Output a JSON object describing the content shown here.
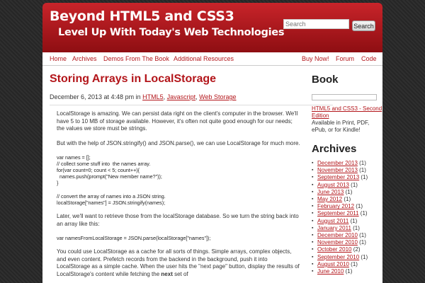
{
  "header": {
    "title": "Beyond HTML5 and CSS3",
    "tagline": "Level Up With Today's Web Technologies",
    "search_placeholder": "Search",
    "search_button": "Search"
  },
  "nav": {
    "left": [
      "Home",
      "Archives",
      "Demos From The Book",
      "Additional Resources"
    ],
    "right": [
      "Buy Now!",
      "Forum",
      "Code"
    ]
  },
  "post": {
    "title": "Storing Arrays in LocalStorage",
    "date_prefix": "December 6, 2013 at 4:48 pm in ",
    "categories": [
      "HTML5",
      "Javascript",
      "Web Storage"
    ],
    "paragraph_1": "LocalStorage is amazing. We can persist data right on the client's computer in the browser.  We'll have 5 to 10 MB of storage available.  However, it's often not quite good enough for our needs; the values we store must be strings.",
    "paragraph_2": "But with the help of JSON.stringify() and JSON.parse(), we can use LocalStorage for much more.",
    "code_1": "var names = [];\n// collect some stuff into  the names array.\nfor(var count=0; count < 5; count++){\n  names.push(prompt(\"New member name?\"));\n}",
    "code_2": "// convert the array of names into a JSON string.\nlocalStorage[\"names\"] = JSON.stringify(names);",
    "paragraph_3": "Later, we'll want to retrieve those from the localStorage database. So we turn the string back into an array like this:",
    "code_3": "var namesFromLocalStorage = JSON.parse(localStorage[\"names\"]);",
    "paragraph_4_before_bold": "You could use LocalStorage as a cache for all sorts of things. Simple arrays, complex objects, and even content. Prefetch records from the backend in the background, push it into LocalStorage as a simple cache. When the user hits the \"next page\" button, display the results of LocalStorage's content while fetching the ",
    "paragraph_4_bold": "next",
    "paragraph_4_after_bold": " set of"
  },
  "sidebar": {
    "book_title": "Book",
    "book_link": "HTML5 and CSS3 - Second Edition",
    "book_desc": "Available in Print, PDF, ePub, or for Kindle!",
    "archives_title": "Archives",
    "archives": [
      {
        "label": "December 2013",
        "count": " (1)"
      },
      {
        "label": "November 2013",
        "count": " (1)"
      },
      {
        "label": "September 2013",
        "count": " (1)"
      },
      {
        "label": "August 2013",
        "count": " (1)"
      },
      {
        "label": "June 2013",
        "count": " (1)"
      },
      {
        "label": "May 2012",
        "count": " (1)"
      },
      {
        "label": "February 2012",
        "count": " (1)"
      },
      {
        "label": "September 2011",
        "count": " (1)"
      },
      {
        "label": "August 2011",
        "count": " (1)"
      },
      {
        "label": "January 2011",
        "count": " (1)"
      },
      {
        "label": "December 2010",
        "count": " (1)"
      },
      {
        "label": "November 2010",
        "count": " (1)"
      },
      {
        "label": "October 2010",
        "count": " (2)"
      },
      {
        "label": "September 2010",
        "count": " (1)"
      },
      {
        "label": "August 2010",
        "count": " (1)"
      },
      {
        "label": "June 2010",
        "count": " (1)"
      }
    ]
  }
}
